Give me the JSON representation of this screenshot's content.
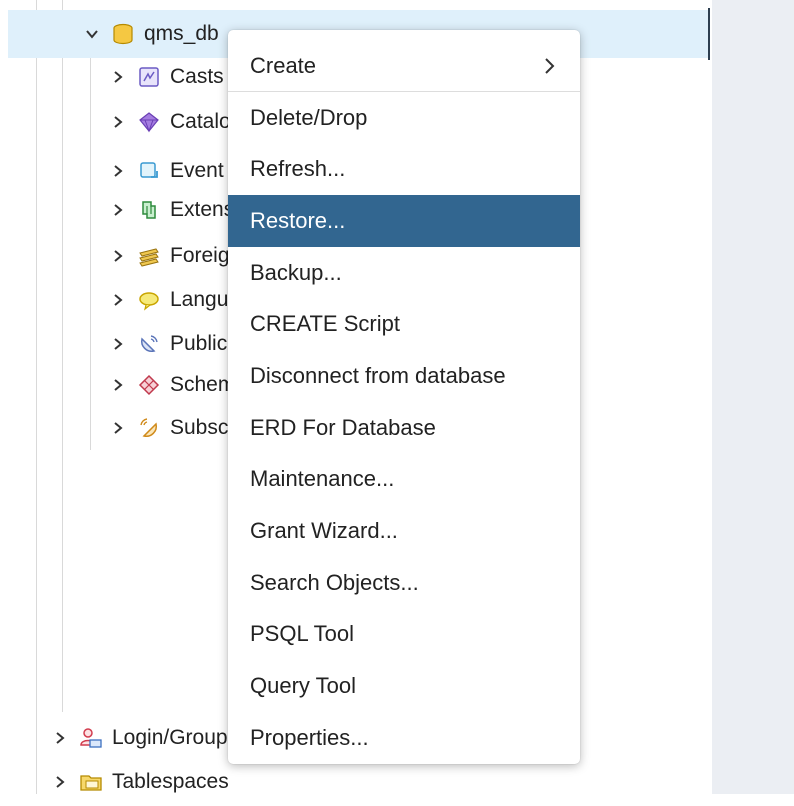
{
  "tree": {
    "database": {
      "label": "qms_db",
      "icon": "database-icon"
    },
    "children": [
      {
        "label": "Casts",
        "icon": "casts-icon"
      },
      {
        "label": "Catalogs",
        "icon": "catalogs-icon"
      },
      {
        "label": "Event Triggers",
        "icon": "event-triggers-icon"
      },
      {
        "label": "Extensions",
        "icon": "extensions-icon"
      },
      {
        "label": "Foreign Data Wrappers",
        "icon": "foreign-data-wrappers-icon"
      },
      {
        "label": "Languages",
        "icon": "languages-icon"
      },
      {
        "label": "Publications",
        "icon": "publications-icon"
      },
      {
        "label": "Schemas",
        "icon": "schemas-icon"
      },
      {
        "label": "Subscriptions",
        "icon": "subscriptions-icon"
      }
    ],
    "server_items": [
      {
        "label": "Login/Group Roles",
        "icon": "login-roles-icon"
      },
      {
        "label": "Tablespaces",
        "icon": "tablespaces-icon"
      }
    ]
  },
  "context_menu": {
    "items": [
      {
        "label": "Create",
        "has_submenu": true
      },
      {
        "label": "Delete/Drop"
      },
      {
        "label": "Refresh..."
      },
      {
        "label": "Restore...",
        "active": true
      },
      {
        "label": "Backup..."
      },
      {
        "label": "CREATE Script"
      },
      {
        "label": "Disconnect from database"
      },
      {
        "label": "ERD For Database"
      },
      {
        "label": "Maintenance..."
      },
      {
        "label": "Grant Wizard..."
      },
      {
        "label": "Search Objects..."
      },
      {
        "label": "PSQL Tool"
      },
      {
        "label": "Query Tool"
      },
      {
        "label": "Properties..."
      }
    ]
  },
  "colors": {
    "selected_row": "#dff0fb",
    "menu_active": "#326690",
    "right_pane": "#ebeef3"
  }
}
